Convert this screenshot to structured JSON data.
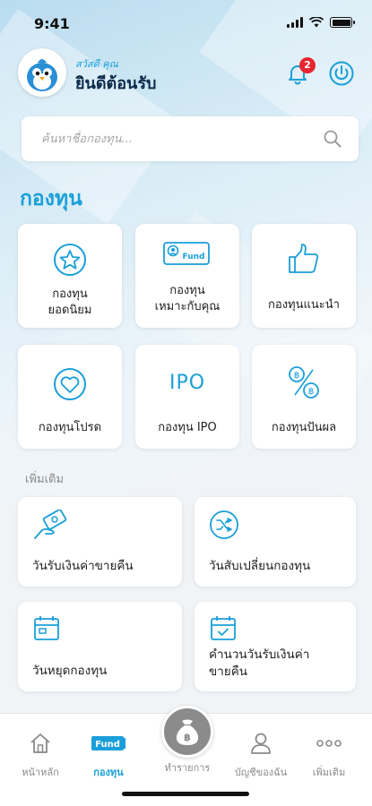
{
  "status_bar": {
    "time": "9:41"
  },
  "header": {
    "greeting_small": "สวัสดี คุณ",
    "greeting_big": "ยินดีต้อนรับ",
    "notification_count": "2"
  },
  "search": {
    "placeholder": "ค้นหาชื่อกองทุน..."
  },
  "section_title": "กองทุน",
  "fund_tiles": [
    {
      "label": "กองทุน\nยอดนิยม",
      "icon": "star-icon"
    },
    {
      "label": "กองทุน\nเหมาะกับคุณ",
      "icon": "fund-card-icon",
      "icon_text": "Fund"
    },
    {
      "label": "กองทุนแนะนำ",
      "icon": "thumbs-up-icon"
    },
    {
      "label": "กองทุนโปรด",
      "icon": "heart-icon"
    },
    {
      "label": "กองทุน IPO",
      "icon": "ipo-icon",
      "icon_text": "IPO"
    },
    {
      "label": "กองทุนปันผล",
      "icon": "dividend-icon"
    }
  ],
  "more_title": "เพิ่มเติม",
  "more_tiles": [
    {
      "label": "วันรับเงินค่าขายคืน",
      "icon": "money-hand-icon"
    },
    {
      "label": "วันสับเปลี่ยนกองทุน",
      "icon": "shuffle-icon"
    },
    {
      "label": "วันหยุดกองทุน",
      "icon": "calendar-icon"
    },
    {
      "label": "คำนวนวันรับเงินค่า\nขายคืน",
      "icon": "calendar-check-icon"
    }
  ],
  "nav": {
    "home": "หน้าหลัก",
    "fund": "กองทุน",
    "fund_icon_text": "Fund",
    "transact": "ทำรายการ",
    "account": "บัญชีของฉัน",
    "more": "เพิ่มเติม"
  },
  "colors": {
    "accent": "#1a9fd9",
    "badge": "#e8262f",
    "center_button": "#8b8b8b"
  }
}
